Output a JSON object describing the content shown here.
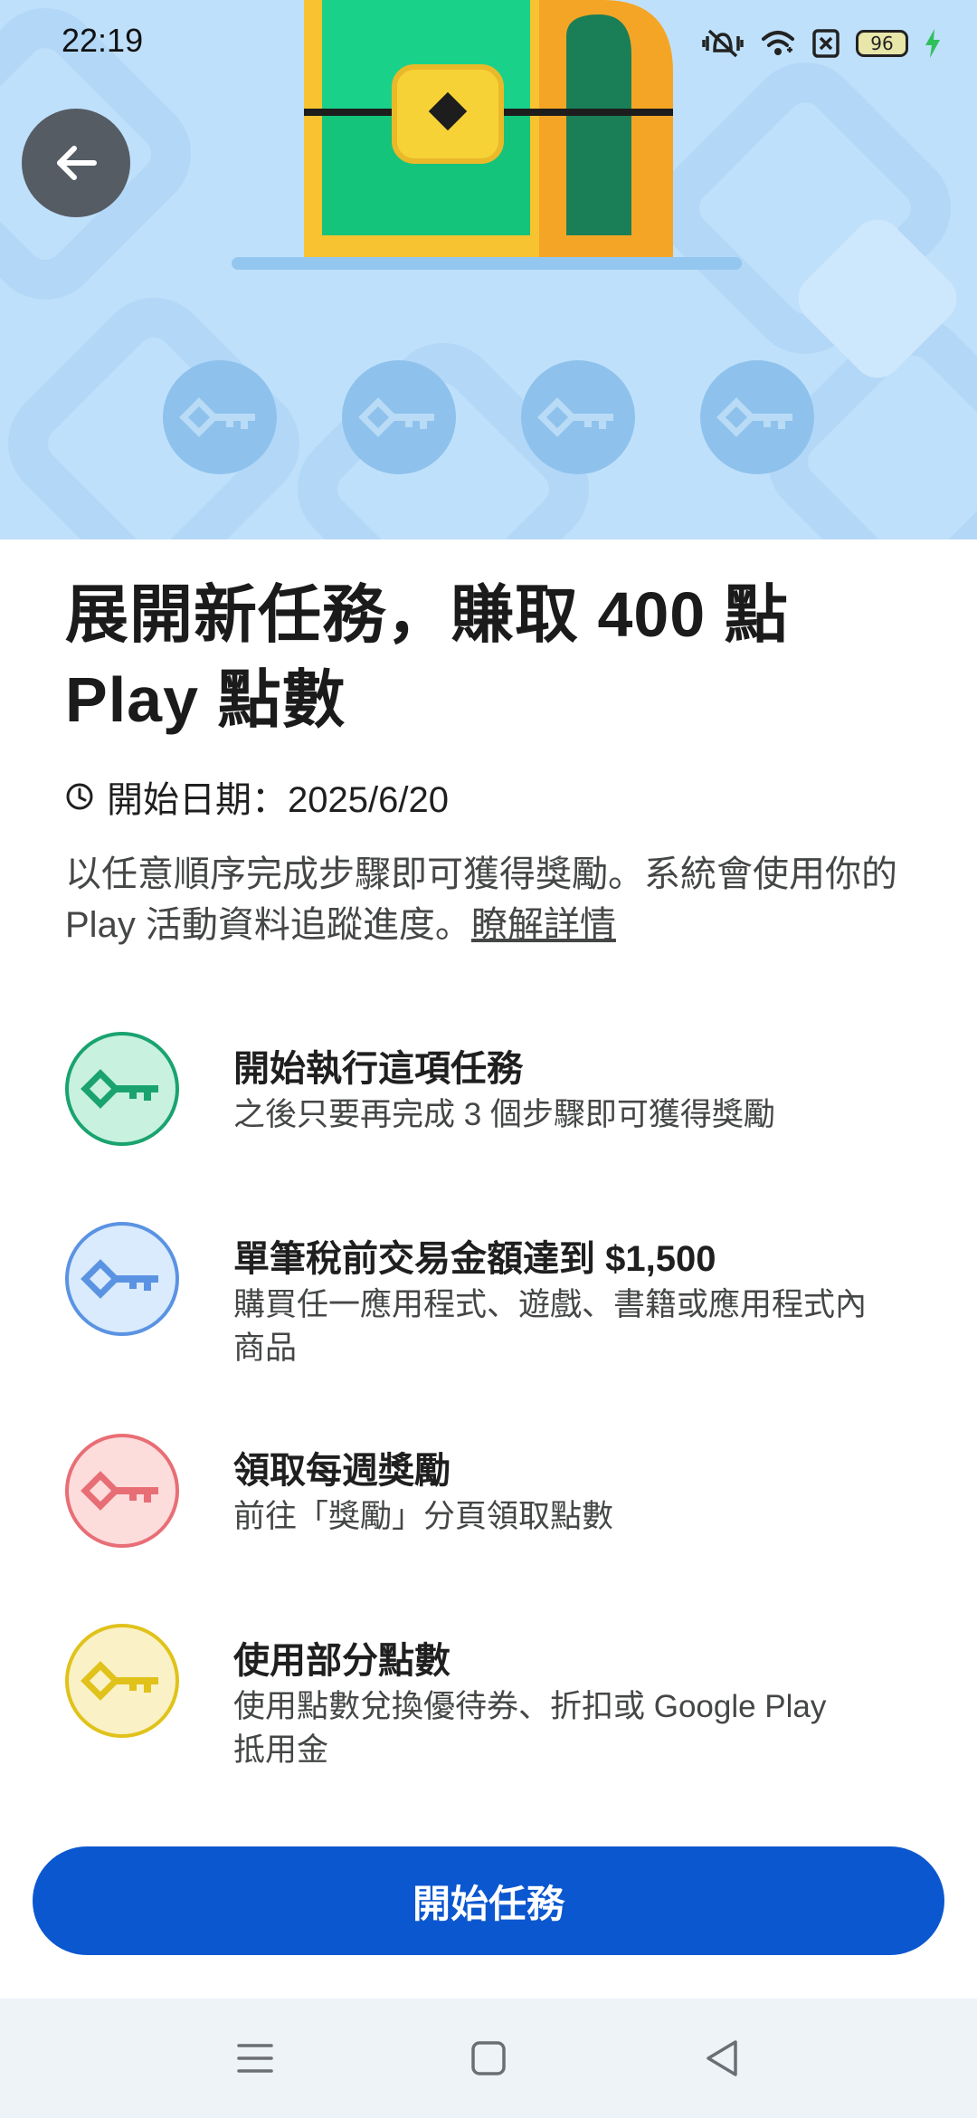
{
  "status_bar": {
    "time": "22:19",
    "battery": "96"
  },
  "hero": {
    "back_label": "back"
  },
  "title": "展開新任務，賺取 400 點 Play 點數",
  "start_date": "開始日期：2025/6/20",
  "description": {
    "text": "以任意順序完成步驟即可獲得獎勵。系統會使用你的 Play 活動資料追蹤進度。",
    "link": "瞭解詳情"
  },
  "tasks": [
    {
      "title": "開始執行這項任務",
      "subtitle": "之後只要再完成 3 個步驟即可獲得獎勵",
      "color": "#1aa36f",
      "bg": "#c8f1df"
    },
    {
      "title": "單筆稅前交易金額達到 $1,500",
      "subtitle": "購買任一應用程式、遊戲、書籍或應用程式內商品",
      "color": "#5b93e3",
      "bg": "#d9ebfc"
    },
    {
      "title": "領取每週獎勵",
      "subtitle": "前往「獎勵」分頁領取點數",
      "color": "#e86e76",
      "bg": "#fddcdc"
    },
    {
      "title": "使用部分點數",
      "subtitle": "使用點數兌換優待券、折扣或 Google Play 抵用金",
      "color": "#e0c21a",
      "bg": "#fbf1c6"
    }
  ],
  "cta": {
    "label": "開始任務"
  },
  "colors": {
    "accent": "#0b57d0",
    "hero_bg": "#bfe0fb"
  }
}
